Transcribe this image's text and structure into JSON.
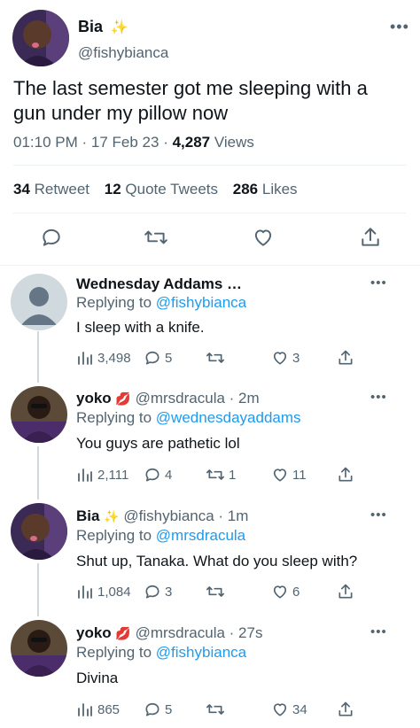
{
  "main_tweet": {
    "name": "Bia",
    "name_emoji": "✨",
    "handle": "@fishybianca",
    "text": "The last semester got me sleeping with a gun under my pillow now",
    "time": "01:10 PM",
    "date": "17 Feb 23",
    "views_count": "4,287",
    "views_label": "Views",
    "retweets_count": "34",
    "retweets_label": "Retweet",
    "quotes_count": "12",
    "quotes_label": "Quote Tweets",
    "likes_count": "286",
    "likes_label": "Likes",
    "more": "•••"
  },
  "replies": [
    {
      "name": "Wednesday Addams …",
      "handle": "",
      "time": "",
      "replying_prefix": "Replying to",
      "replying_to": "@fishybianca",
      "text": "I sleep with a knife.",
      "views": "3,498",
      "replies": "5",
      "retweets": "",
      "likes": "3",
      "more": "•••"
    },
    {
      "name": "yoko",
      "emoji": "💋",
      "handle": "@mrsdracula · 2m",
      "replying_prefix": "Replying to",
      "replying_to": "@wednesdayaddams",
      "text": "You guys are pathetic lol",
      "views": "2,111",
      "replies": "4",
      "retweets": "1",
      "likes": "11",
      "more": "•••"
    },
    {
      "name": "Bia",
      "emoji": "✨",
      "handle": "@fishybianca · 1m",
      "replying_prefix": "Replying to",
      "replying_to": "@mrsdracula",
      "text": "Shut up, Tanaka. What do you sleep with?",
      "views": "1,084",
      "replies": "3",
      "retweets": "",
      "likes": "6",
      "more": "•••"
    },
    {
      "name": "yoko",
      "emoji": "💋",
      "handle": "@mrsdracula · 27s",
      "replying_prefix": "Replying to",
      "replying_to": "@fishybianca",
      "text": "Divina",
      "views": "865",
      "replies": "5",
      "retweets": "",
      "likes": "34",
      "more": "•••"
    }
  ],
  "colors": {
    "text": "#0f1419",
    "secondary": "#536471",
    "link": "#1d9bf0",
    "divider": "#eff3f4"
  }
}
